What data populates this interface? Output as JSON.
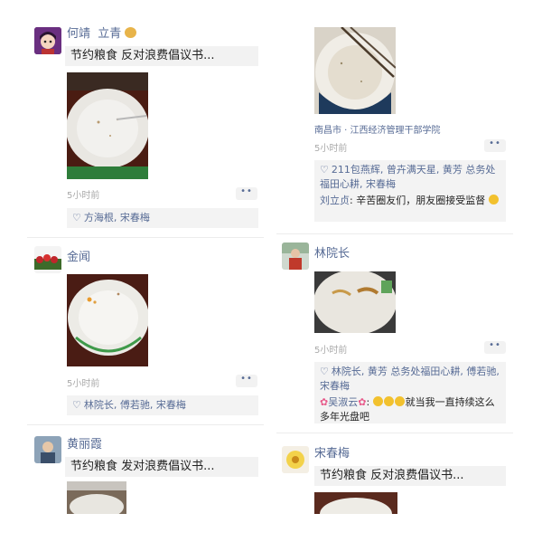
{
  "left": {
    "posts": [
      {
        "name": "何靖",
        "share_text": "节约粮食 反对浪费倡议书...",
        "time": "5小时前",
        "more": "••",
        "likes": "方海根, 宋春梅",
        "avatar_icon": "anime-girl-avatar"
      },
      {
        "name": "金闻",
        "time": "5小时前",
        "more": "••",
        "likes": "林院长, 傅若驰, 宋春梅",
        "avatar_icon": "red-flowers-avatar"
      },
      {
        "name": "黄丽霞",
        "share_text": "节约粮食 发对浪费倡议书...",
        "avatar_icon": "child-photo-avatar"
      }
    ],
    "post1_extra_name": "立青"
  },
  "right": {
    "posts": [
      {
        "location": "南昌市 · 江西经济管理干部学院",
        "time": "5小时前",
        "more": "••",
        "likes": "211包燕辉, 曾卉满天星, 黄芳 总务处福田心耕, 宋春梅",
        "comment_name": "刘立贞",
        "comment_text": ": 辛苦圈友们，朋友圈接受监督"
      },
      {
        "name": "林院长",
        "time": "5小时前",
        "more": "••",
        "likes": "林院长, 黄芳 总务处福田心耕, 傅若驰, 宋春梅",
        "comment_name": "吴淑云",
        "comment_text": "就当我一直持续这么多年光盘吧",
        "avatar_icon": "person-photo-avatar"
      },
      {
        "name": "宋春梅",
        "share_text": "节约粮食 反对浪费倡议书...",
        "avatar_icon": "yellow-flower-avatar"
      }
    ]
  },
  "colors": {
    "link": "#576b95",
    "panel": "#f3f3f3",
    "time": "#aaaaaa"
  }
}
